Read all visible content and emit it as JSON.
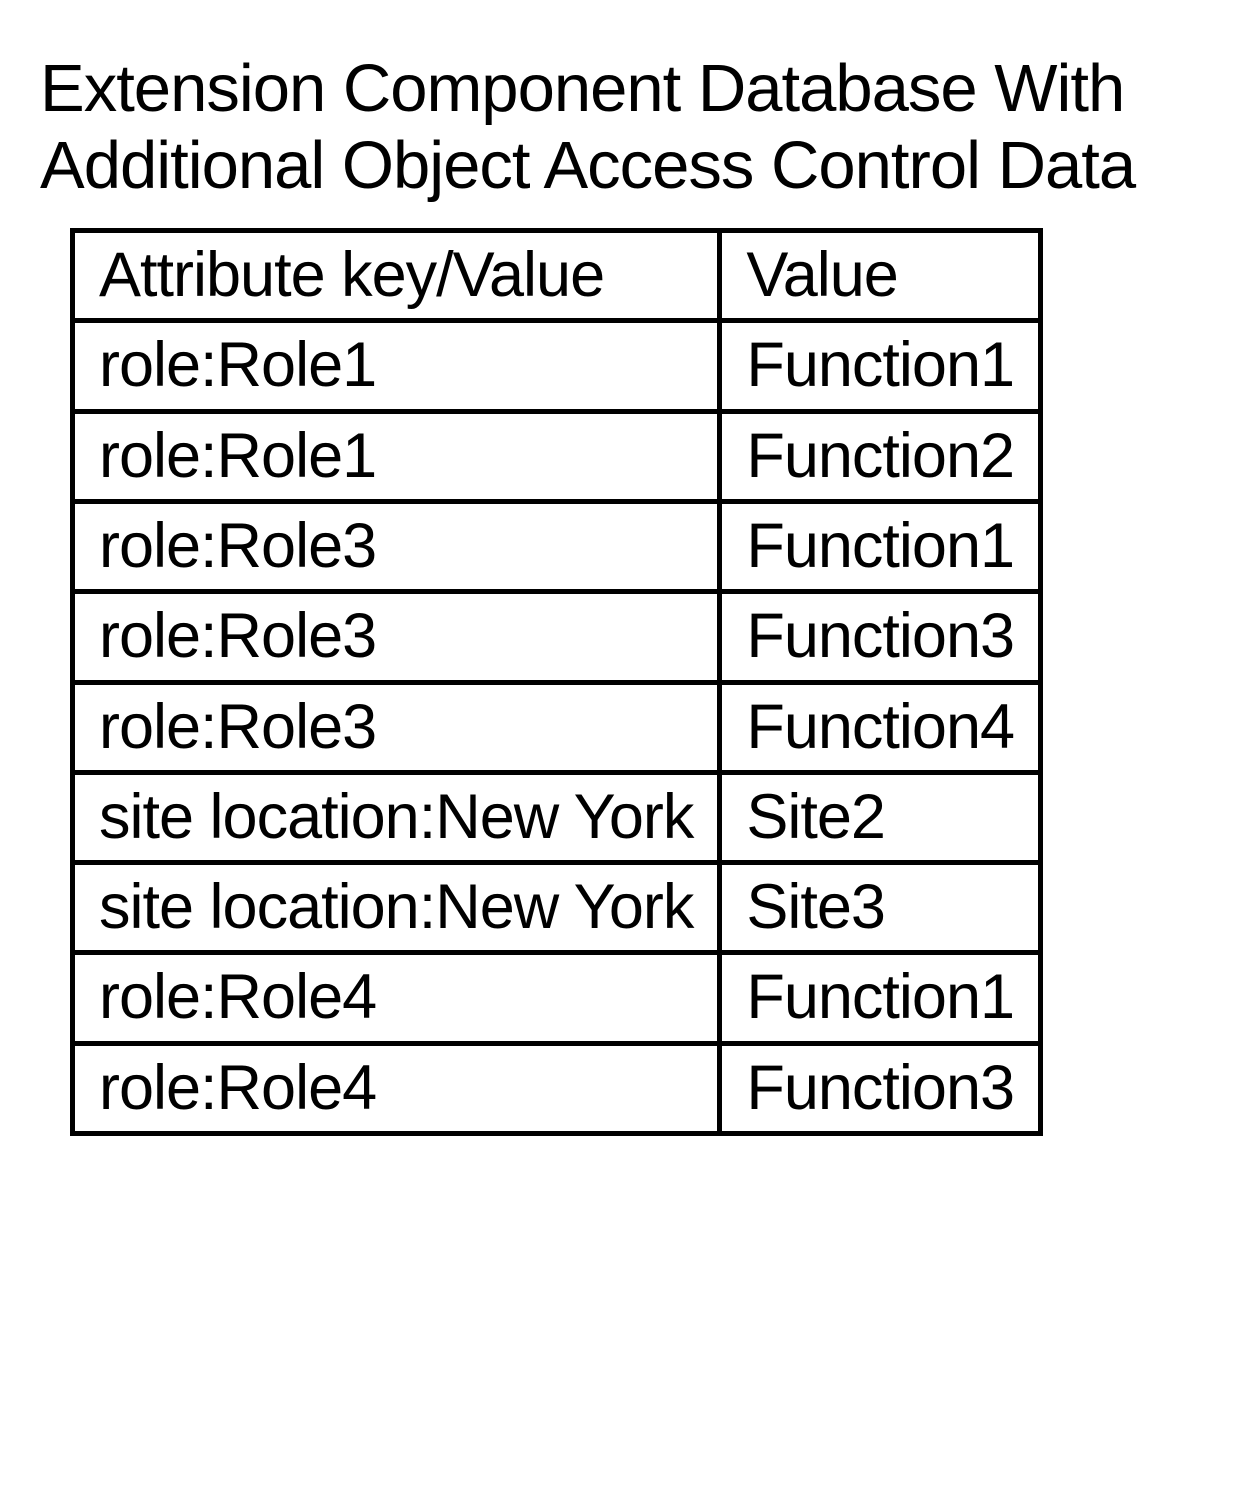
{
  "title_line1": "Extension Component Database With",
  "title_line2": "Additional Object Access Control Data",
  "headers": {
    "col1": "Attribute key/Value",
    "col2": "Value"
  },
  "rows": [
    {
      "key": "role:Role1",
      "value": "Function1"
    },
    {
      "key": "role:Role1",
      "value": "Function2"
    },
    {
      "key": "role:Role3",
      "value": "Function1"
    },
    {
      "key": "role:Role3",
      "value": "Function3"
    },
    {
      "key": "role:Role3",
      "value": "Function4"
    },
    {
      "key": "site location:New York",
      "value": "Site2"
    },
    {
      "key": "site location:New York",
      "value": "Site3"
    },
    {
      "key": "role:Role4",
      "value": "Function1"
    },
    {
      "key": "role:Role4",
      "value": "Function3"
    }
  ]
}
